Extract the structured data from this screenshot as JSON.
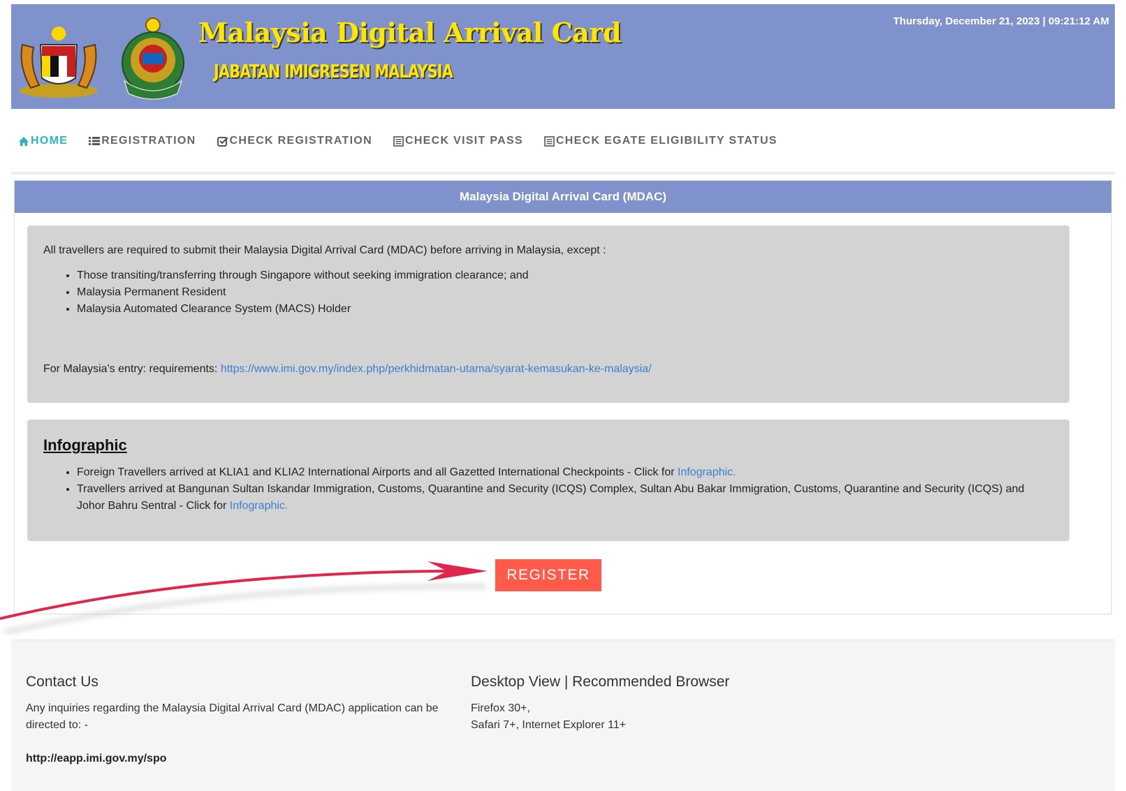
{
  "header": {
    "title": "Malaysia Digital Arrival Card",
    "subtitle": "JABATAN IMIGRESEN MALAYSIA",
    "datetime": "Thursday, December 21, 2023 | 09:21:12 AM",
    "colors": {
      "banner": "#8092cc",
      "title": "#ffe600"
    }
  },
  "nav": {
    "items": [
      {
        "label": "HOME",
        "icon": "home-icon",
        "active": true
      },
      {
        "label": "REGISTRATION",
        "icon": "list-icon",
        "active": false
      },
      {
        "label": "CHECK REGISTRATION",
        "icon": "check-square-icon",
        "active": false
      },
      {
        "label": "CHECK VISIT PASS",
        "icon": "document-icon",
        "active": false
      },
      {
        "label": "CHECK EGATE ELIGIBILITY STATUS",
        "icon": "document-icon",
        "active": false
      }
    ]
  },
  "panel": {
    "title": "Malaysia Digital Arrival Card (MDAC)",
    "intro": "All travellers are required to submit their Malaysia Digital Arrival Card (MDAC) before arriving in Malaysia, except :",
    "exceptions": [
      "Those transiting/transferring through Singapore without seeking immigration clearance; and",
      "Malaysia Permanent Resident",
      "Malaysia Automated Clearance System (MACS) Holder"
    ],
    "requirements_label": "For Malaysia's entry: requirements:",
    "requirements_link": "https://www.imi.gov.my/index.php/perkhidmatan-utama/syarat-kemasukan-ke-malaysia/"
  },
  "infographic": {
    "title": "Infographic",
    "items": [
      {
        "text": "Foreign Travellers arrived at KLIA1 and KLIA2 International Airports and all Gazetted International Checkpoints - Click for ",
        "link": "Infographic."
      },
      {
        "text": "Travellers arrived at Bangunan Sultan Iskandar Immigration, Customs, Quarantine and Security (ICQS) Complex, Sultan Abu Bakar Immigration, Customs, Quarantine and Security (ICQS) and Johor Bahru Sentral - Click for ",
        "link": "Infographic."
      }
    ]
  },
  "register": {
    "label": "REGISTER",
    "color": "#ff5a4a"
  },
  "footer": {
    "contact_title": "Contact Us",
    "contact_text": "Any inquiries regarding the Malaysia Digital Arrival Card (MDAC) application can be directed to: -",
    "contact_link": "http://eapp.imi.gov.my/spo",
    "browser_title": "Desktop View | Recommended Browser",
    "browser_line1": "Firefox 30+,",
    "browser_line2": "Safari 7+, Internet Explorer 11+"
  }
}
